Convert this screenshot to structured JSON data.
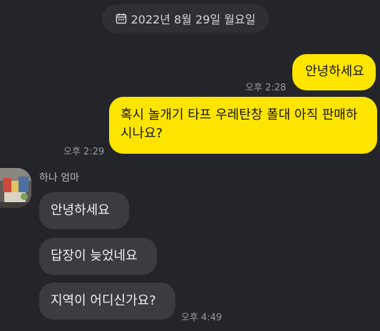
{
  "date_divider": {
    "icon": "calendar-icon",
    "text": "2022년 8월 29일 월요일"
  },
  "messages_sent": [
    {
      "text": "안녕하세요",
      "time": "오후 2:28"
    },
    {
      "line1": "혹시 놀개기 타프 우레탄창 폴대 아직 판매하",
      "line2": "시나요?",
      "time": "오후 2:29"
    }
  ],
  "sender": {
    "name": "하나 엄마"
  },
  "messages_received": [
    {
      "text": "안녕하세요"
    },
    {
      "text": "답장이 늦었네요"
    },
    {
      "text": "지역이 어디신가요?",
      "time": "오후 4:49"
    }
  ],
  "colors": {
    "background": "#24252a",
    "sent_bubble": "#fee500",
    "received_bubble": "#3b3c42",
    "date_chip": "#2f3035"
  }
}
